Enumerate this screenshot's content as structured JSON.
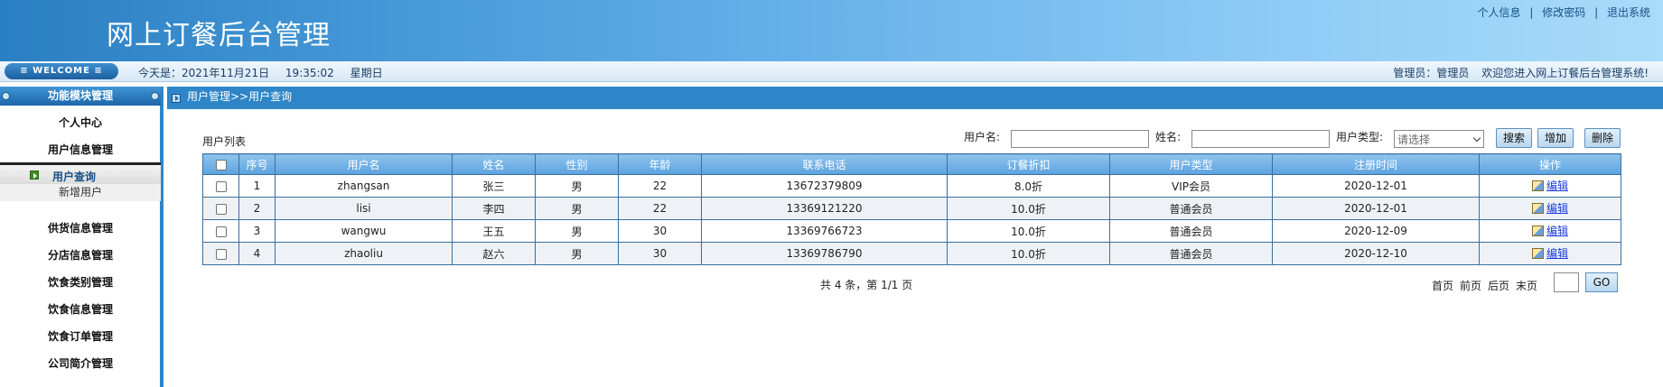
{
  "header": {
    "title": "网上订餐后台管理",
    "links": [
      "个人信息",
      "修改密码",
      "退出系统"
    ],
    "separator": "|"
  },
  "infobar": {
    "welcome": "≡ WELCOME ≡",
    "date_label": "今天是：2021年11月21日",
    "time": "19:35:02",
    "weekday": "星期日",
    "admin": "管理员：管理员",
    "welcome_msg": "欢迎您进入网上订餐后台管理系统!"
  },
  "sidebar": {
    "title": "功能模块管理",
    "items": [
      "个人中心",
      "用户信息管理",
      "用户查询",
      "新增用户",
      "供货信息管理",
      "分店信息管理",
      "饮食类别管理",
      "饮食信息管理",
      "饮食订单管理",
      "公司简介管理"
    ]
  },
  "main": {
    "breadcrumb": "用户管理>>用户查询",
    "list_title": "用户列表",
    "search": {
      "username_label": "用户名:",
      "name_label": "姓名:",
      "type_label": "用户类型:",
      "type_placeholder": "请选择",
      "search_btn": "搜索",
      "add_btn": "增加",
      "delete_btn": "删除"
    },
    "table": {
      "headers": [
        "序号",
        "用户名",
        "姓名",
        "性别",
        "年龄",
        "联系电话",
        "订餐折扣",
        "用户类型",
        "注册时间",
        "操作"
      ],
      "rows": [
        [
          "1",
          "zhangsan",
          "张三",
          "男",
          "22",
          "13672379809",
          "8.0折",
          "VIP会员",
          "2020-12-01",
          "编辑"
        ],
        [
          "2",
          "lisi",
          "李四",
          "男",
          "22",
          "13369121220",
          "10.0折",
          "普通会员",
          "2020-12-01",
          "编辑"
        ],
        [
          "3",
          "wangwu",
          "王五",
          "男",
          "30",
          "13369766723",
          "10.0折",
          "普通会员",
          "2020-12-09",
          "编辑"
        ],
        [
          "4",
          "zhaoliu",
          "赵六",
          "男",
          "30",
          "13369786790",
          "10.0折",
          "普通会员",
          "2020-12-10",
          "编辑"
        ]
      ]
    },
    "pager": {
      "info": "共 4 条，第 1/1 页",
      "first": "首页",
      "prev": "前页",
      "next": "后页",
      "last": "末页",
      "go": "GO"
    }
  }
}
